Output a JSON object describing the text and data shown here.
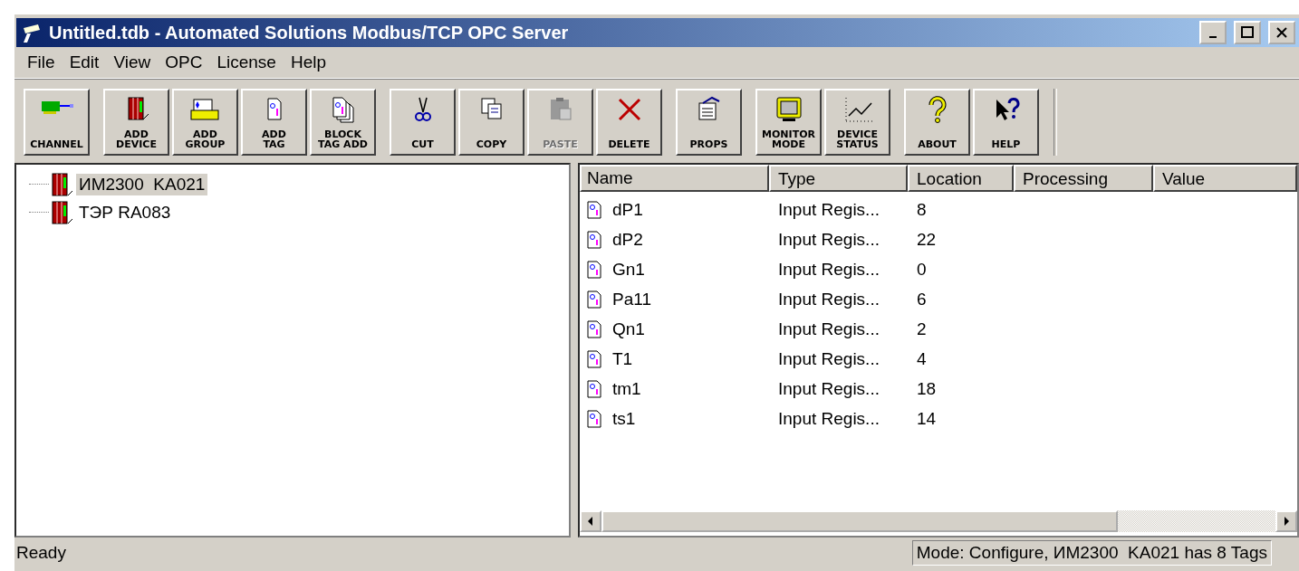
{
  "window": {
    "title": "Untitled.tdb - Automated Solutions Modbus/TCP OPC Server"
  },
  "menu": [
    {
      "label": "File"
    },
    {
      "label": "Edit"
    },
    {
      "label": "View"
    },
    {
      "label": "OPC"
    },
    {
      "label": "License"
    },
    {
      "label": "Help"
    }
  ],
  "toolbar": {
    "groups": [
      [
        {
          "lines": [
            "CHANNEL"
          ],
          "disabled": false
        }
      ],
      [
        {
          "lines": [
            "ADD",
            "DEVICE"
          ],
          "disabled": false
        },
        {
          "lines": [
            "ADD",
            "GROUP"
          ],
          "disabled": false
        },
        {
          "lines": [
            "ADD",
            "TAG"
          ],
          "disabled": false
        },
        {
          "lines": [
            "BLOCK",
            "TAG ADD"
          ],
          "disabled": false
        }
      ],
      [
        {
          "lines": [
            "CUT"
          ],
          "disabled": false
        },
        {
          "lines": [
            "COPY"
          ],
          "disabled": false
        },
        {
          "lines": [
            "PASTE"
          ],
          "disabled": true
        },
        {
          "lines": [
            "DELETE"
          ],
          "disabled": false
        }
      ],
      [
        {
          "lines": [
            "PROPS"
          ],
          "disabled": false
        }
      ],
      [
        {
          "lines": [
            "MONITOR",
            "MODE"
          ],
          "disabled": false
        },
        {
          "lines": [
            "DEVICE",
            "STATUS"
          ],
          "disabled": false
        }
      ],
      [
        {
          "lines": [
            "ABOUT"
          ],
          "disabled": false
        },
        {
          "lines": [
            "HELP"
          ],
          "disabled": false
        }
      ]
    ]
  },
  "tree": {
    "items": [
      {
        "label": "ИМ2300  KA021",
        "selected": true
      },
      {
        "label": "ТЭР RA083",
        "selected": false
      }
    ]
  },
  "table": {
    "columns": [
      "Name",
      "Type",
      "Location",
      "Processing",
      "Value"
    ],
    "rows": [
      {
        "name": "dP1",
        "type": "Input Regis...",
        "location": "8"
      },
      {
        "name": "dP2",
        "type": "Input Regis...",
        "location": "22"
      },
      {
        "name": "Gn1",
        "type": "Input Regis...",
        "location": "0"
      },
      {
        "name": "Pa11",
        "type": "Input Regis...",
        "location": "6"
      },
      {
        "name": "Qn1",
        "type": "Input Regis...",
        "location": "2"
      },
      {
        "name": "T1",
        "type": "Input Regis...",
        "location": "4"
      },
      {
        "name": "tm1",
        "type": "Input Regis...",
        "location": "18"
      },
      {
        "name": "ts1",
        "type": "Input Regis...",
        "location": "14"
      }
    ]
  },
  "status_bar": {
    "message": "Ready",
    "mode": "Mode: Configure, ИМ2300  KA021 has 8 Tags"
  }
}
